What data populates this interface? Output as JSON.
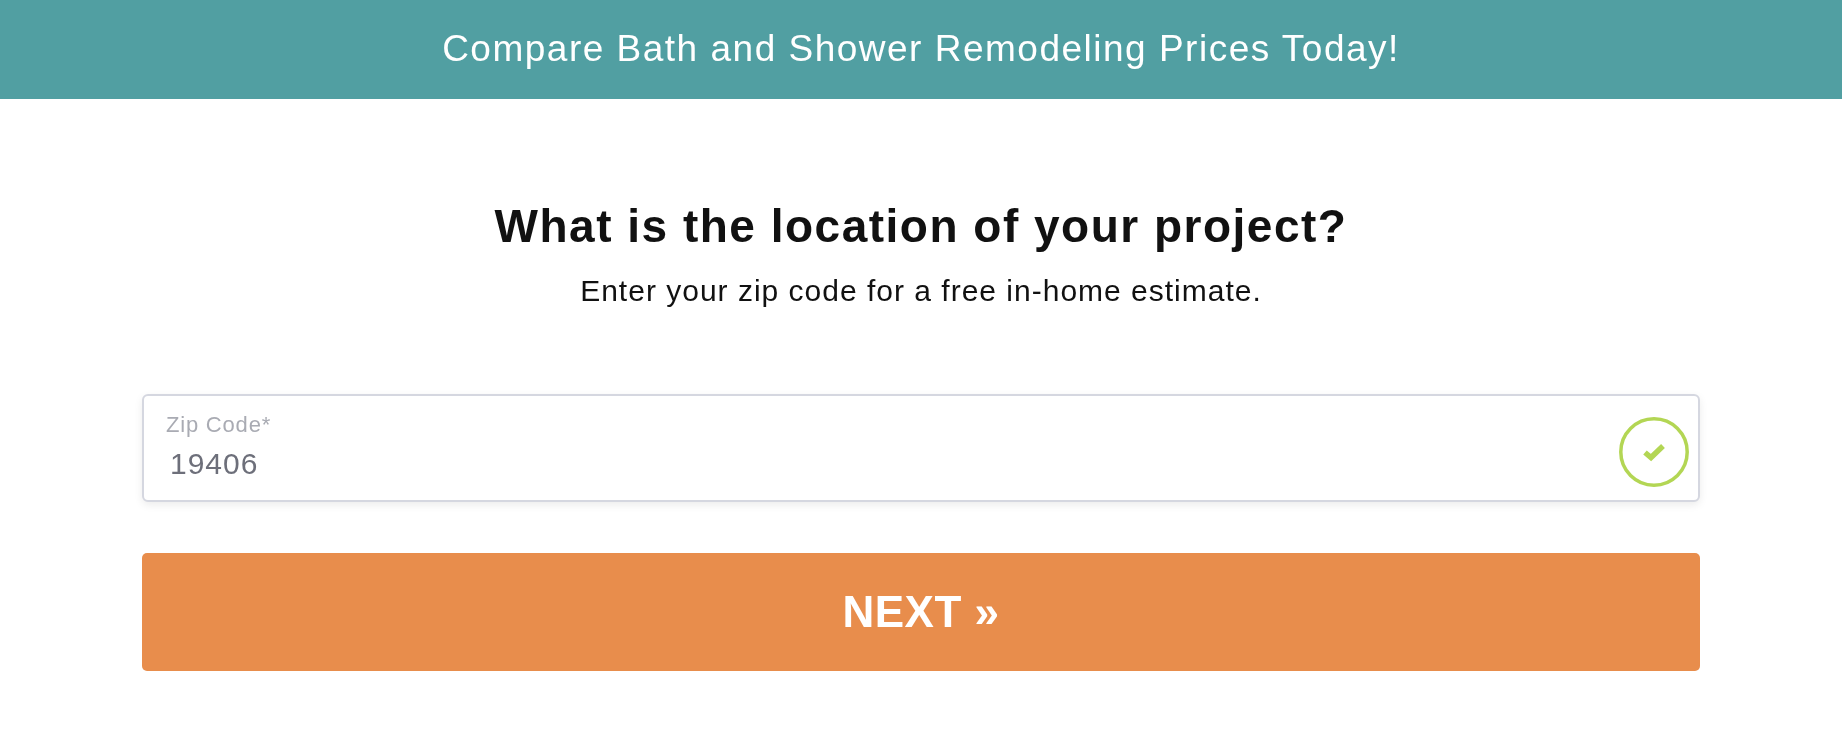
{
  "banner": {
    "text": "Compare Bath and Shower Remodeling Prices Today!"
  },
  "heading": "What is the location of your project?",
  "subtitle": "Enter your zip code for a free in-home estimate.",
  "zip_field": {
    "label": "Zip Code*",
    "value": "19406",
    "valid": true
  },
  "next_button": {
    "label": "NEXT »"
  }
}
